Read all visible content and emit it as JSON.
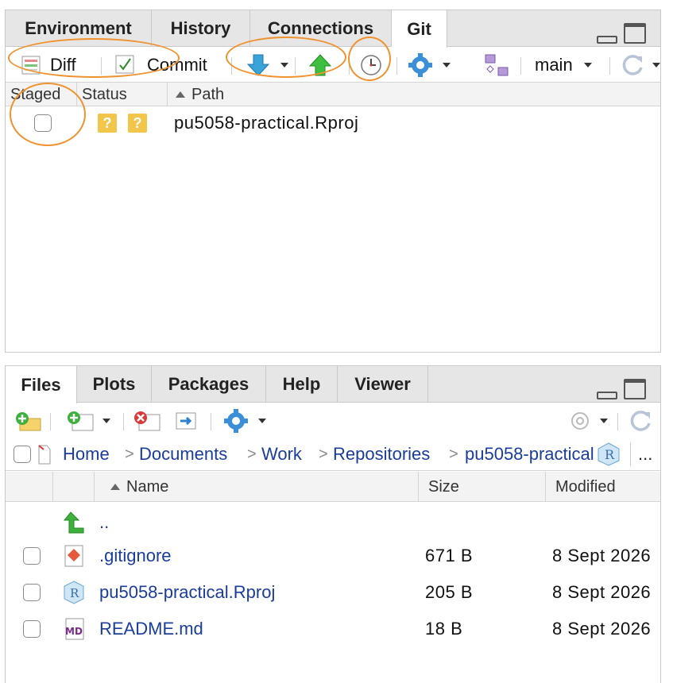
{
  "git_pane": {
    "tabs": [
      {
        "label": "Environment"
      },
      {
        "label": "History"
      },
      {
        "label": "Connections"
      },
      {
        "label": "Git",
        "active": true
      }
    ],
    "toolbar": {
      "diff_label": "Diff",
      "commit_label": "Commit",
      "branch_label": "main"
    },
    "columns": {
      "staged": "Staged",
      "status": "Status",
      "path": "Path"
    },
    "rows": [
      {
        "staged": false,
        "status": [
          "?",
          "?"
        ],
        "path": "pu5058-practical.Rproj"
      }
    ]
  },
  "files_pane": {
    "tabs": [
      {
        "label": "Files",
        "active": true
      },
      {
        "label": "Plots"
      },
      {
        "label": "Packages"
      },
      {
        "label": "Help"
      },
      {
        "label": "Viewer"
      }
    ],
    "breadcrumb": [
      "Home",
      "Documents",
      "Work",
      "Repositories",
      "pu5058-practical"
    ],
    "more_label": "...",
    "columns": {
      "name": "Name",
      "size": "Size",
      "modified": "Modified"
    },
    "parent_link": "..",
    "files": [
      {
        "name": ".gitignore",
        "size": "671 B",
        "modified": "8 Sept 2026",
        "icon": "git-file-icon"
      },
      {
        "name": "pu5058-practical.Rproj",
        "size": "205 B",
        "modified": "8 Sept 2026",
        "icon": "rproj-file-icon"
      },
      {
        "name": "README.md",
        "size": "18 B",
        "modified": "8 Sept 2026",
        "icon": "markdown-file-icon"
      }
    ]
  },
  "colors": {
    "highlight_ring": "#f0922f",
    "link": "#1a3d9c",
    "status_badge": "#f2c54b"
  }
}
